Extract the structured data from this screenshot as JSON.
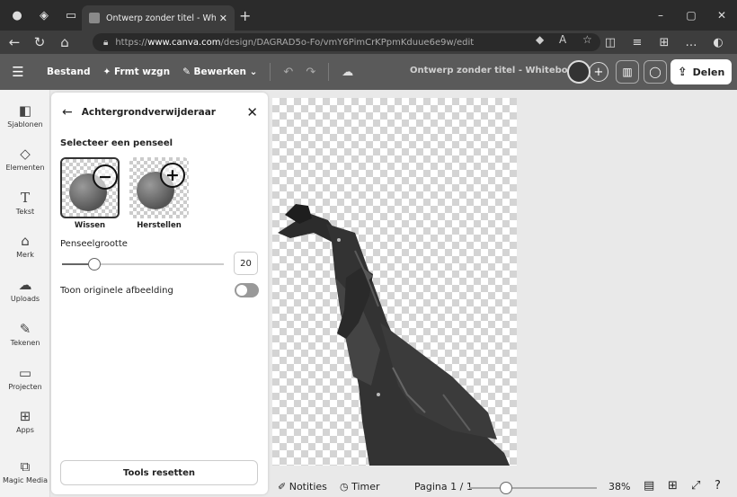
{
  "browser": {
    "tab_title": "Ontwerp zonder titel - Whiteboard",
    "url_prefix": "https://",
    "url_host": "www.canva.com",
    "url_path": "/design/DAGRAD5o-Fo/vmY6PimCrKPpmKduue6e9w/edit"
  },
  "header": {
    "menu": [
      "Bestand",
      "Frmt wzgn",
      "Bewerken"
    ],
    "doc_title": "Ontwerp zonder titel - Whiteboard",
    "share_label": "Delen"
  },
  "leftnav": [
    {
      "label": "Sjablonen",
      "icon": "template-icon"
    },
    {
      "label": "Elementen",
      "icon": "elements-icon"
    },
    {
      "label": "Tekst",
      "icon": "text-icon"
    },
    {
      "label": "Merk",
      "icon": "brand-icon"
    },
    {
      "label": "Uploads",
      "icon": "upload-icon"
    },
    {
      "label": "Tekenen",
      "icon": "draw-icon"
    },
    {
      "label": "Projecten",
      "icon": "folder-icon"
    },
    {
      "label": "Apps",
      "icon": "apps-icon"
    },
    {
      "label": "Magic Media",
      "icon": "magic-media-icon"
    }
  ],
  "panel": {
    "title": "Achtergrondverwijderaar",
    "brush_heading": "Selecteer een penseel",
    "brushes": [
      {
        "label": "Wissen",
        "symbol": "−",
        "selected": true
      },
      {
        "label": "Herstellen",
        "symbol": "+",
        "selected": false
      }
    ],
    "brush_size_label": "Penseelgrootte",
    "brush_size_value": "20",
    "brush_size_fraction": 0.2,
    "show_original_label": "Toon originele afbeelding",
    "show_original_on": false,
    "reset_label": "Tools resetten"
  },
  "footer": {
    "notes": "Notities",
    "timer": "Timer",
    "page": "Pagina 1 / 1",
    "zoom": "38%",
    "zoom_fraction": 0.38
  }
}
